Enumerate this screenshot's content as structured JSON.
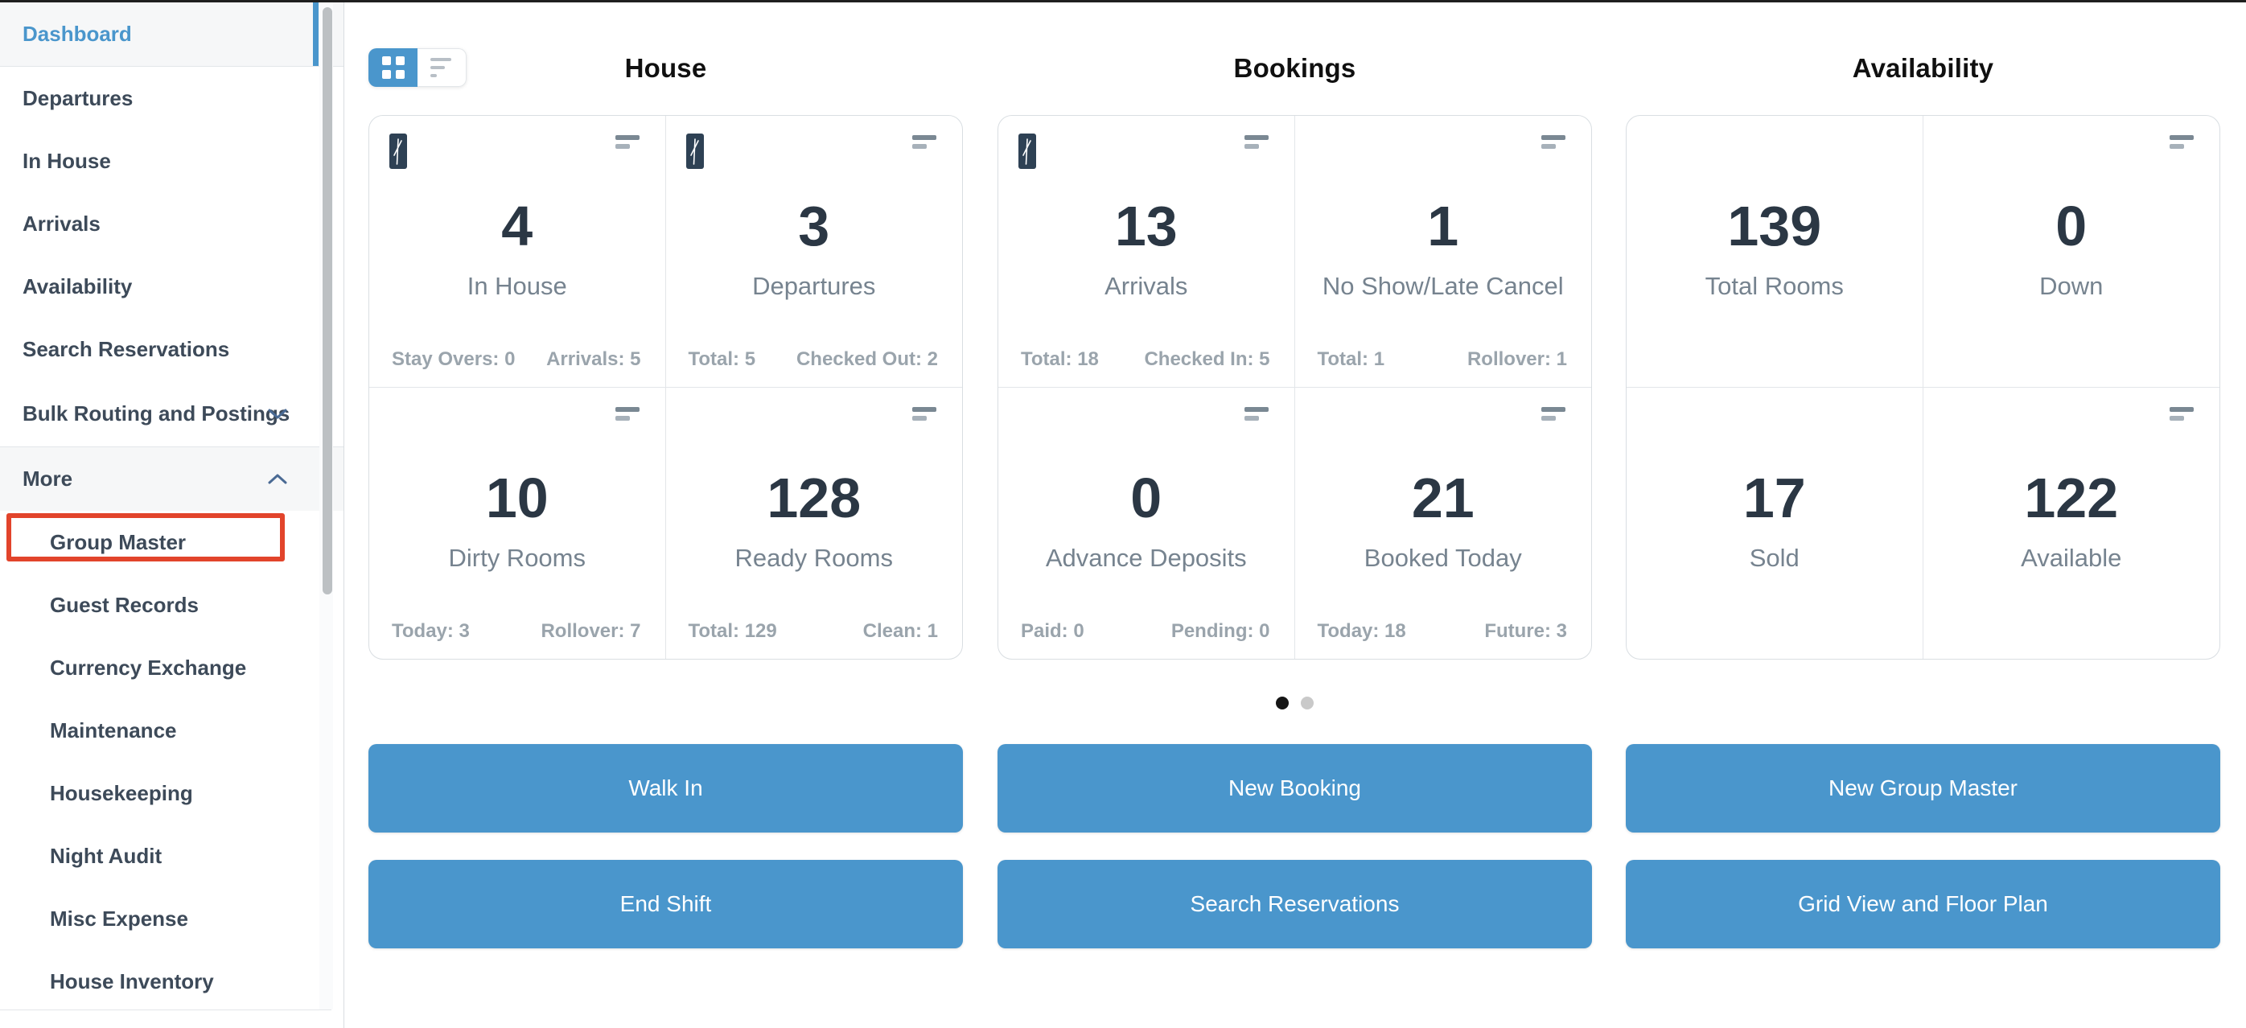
{
  "sidebar": {
    "items": [
      {
        "label": "Dashboard",
        "active": true
      },
      {
        "label": "Departures"
      },
      {
        "label": "In House"
      },
      {
        "label": "Arrivals"
      },
      {
        "label": "Availability"
      },
      {
        "label": "Search Reservations"
      },
      {
        "label": "Bulk Routing and Postings",
        "chevron": "down"
      },
      {
        "label": "More",
        "chevron": "up"
      }
    ],
    "more_items": [
      {
        "label": "Group Master",
        "highlighted": true
      },
      {
        "label": "Guest Records"
      },
      {
        "label": "Currency Exchange"
      },
      {
        "label": "Maintenance"
      },
      {
        "label": "Housekeeping"
      },
      {
        "label": "Night Audit"
      },
      {
        "label": "Misc Expense"
      },
      {
        "label": "House Inventory"
      }
    ]
  },
  "view_toggle": {
    "selected": "grid",
    "options": [
      "grid",
      "list"
    ]
  },
  "columns": [
    {
      "title": "House",
      "cards": [
        {
          "value": "4",
          "label": "In House",
          "sub_left": "Stay Overs: 0",
          "sub_right": "Arrivals: 5",
          "badge": true,
          "menu": true
        },
        {
          "value": "3",
          "label": "Departures",
          "sub_left": "Total: 5",
          "sub_right": "Checked Out: 2",
          "badge": true,
          "menu": true
        },
        {
          "value": "10",
          "label": "Dirty Rooms",
          "sub_left": "Today: 3",
          "sub_right": "Rollover: 7",
          "badge": false,
          "menu": true
        },
        {
          "value": "128",
          "label": "Ready Rooms",
          "sub_left": "Total: 129",
          "sub_right": "Clean: 1",
          "badge": false,
          "menu": true
        }
      ],
      "buttons": [
        "Walk In",
        "End Shift"
      ]
    },
    {
      "title": "Bookings",
      "cards": [
        {
          "value": "13",
          "label": "Arrivals",
          "sub_left": "Total: 18",
          "sub_right": "Checked In: 5",
          "badge": true,
          "menu": true
        },
        {
          "value": "1",
          "label": "No Show/Late Cancel",
          "sub_left": "Total: 1",
          "sub_right": "Rollover: 1",
          "badge": false,
          "menu": true
        },
        {
          "value": "0",
          "label": "Advance Deposits",
          "sub_left": "Paid: 0",
          "sub_right": "Pending: 0",
          "badge": false,
          "menu": true
        },
        {
          "value": "21",
          "label": "Booked Today",
          "sub_left": "Today: 18",
          "sub_right": "Future: 3",
          "badge": false,
          "menu": true
        }
      ],
      "buttons": [
        "New Booking",
        "Search Reservations"
      ]
    },
    {
      "title": "Availability",
      "cards": [
        {
          "value": "139",
          "label": "Total Rooms",
          "badge": false,
          "menu": false
        },
        {
          "value": "0",
          "label": "Down",
          "badge": false,
          "menu": true
        },
        {
          "value": "17",
          "label": "Sold",
          "badge": false,
          "menu": false
        },
        {
          "value": "122",
          "label": "Available",
          "badge": false,
          "menu": true
        }
      ],
      "buttons": [
        "New Group Master",
        "Grid View and Floor Plan"
      ]
    }
  ],
  "pagination": {
    "dots": [
      {
        "active": true
      },
      {
        "active": false
      }
    ]
  },
  "icons": {
    "grid-view-icon": "2x2 squares",
    "list-view-icon": "three shrinking bars",
    "card-menu-icon": "two shrinking bars",
    "chevron-down-icon": "v",
    "chevron-up-icon": "^",
    "report-badge-icon": "dark tag with white scribble"
  },
  "colors": {
    "accent_blue": "#4a96cc",
    "highlight_red": "#e2442b",
    "badge_navy": "#2e4154",
    "number_dark": "#2b3744",
    "label_gray": "#76838f",
    "substat_gray": "#9aa4ac",
    "divider_gray": "#e3e6e9",
    "dot_active": "#161616",
    "dot_inactive": "#c9c9c9"
  }
}
